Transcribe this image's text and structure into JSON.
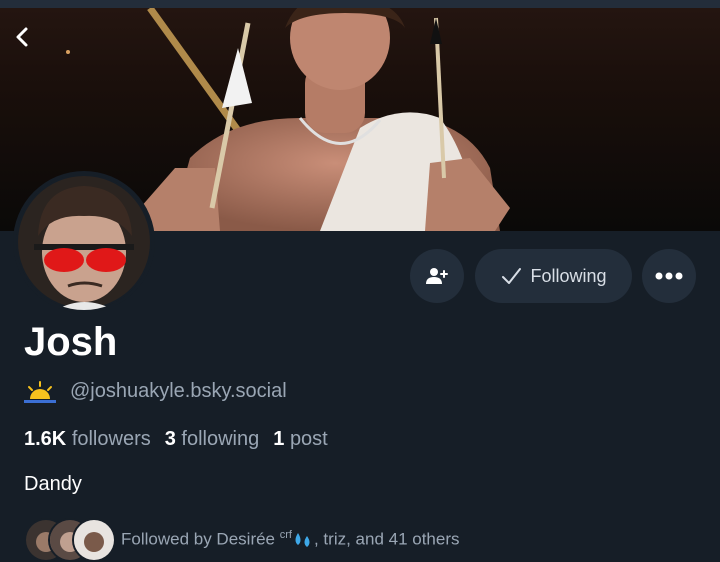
{
  "header": {
    "back_icon": "chevron-left-icon"
  },
  "profile": {
    "name": "Josh",
    "handle": "@joshuakyle.bsky.social",
    "handle_emoji_icon": "sunrise-icon",
    "bio": "Dandy"
  },
  "stats": {
    "followers_count": "1.6K",
    "followers_label": "followers",
    "following_count": "3",
    "following_label": "following",
    "posts_count": "1",
    "posts_label": "post"
  },
  "actions": {
    "add_user_icon": "add-user-icon",
    "following_label": "Following",
    "more_icon": "more-horizontal-icon"
  },
  "followed_by": {
    "prefix": "Followed by Desirée",
    "sup": "crf",
    "suffix": ", triz, and 41 others"
  },
  "colors": {
    "background": "#161e27",
    "button_bg": "#232e3b",
    "muted_text": "#9aa6b4"
  }
}
